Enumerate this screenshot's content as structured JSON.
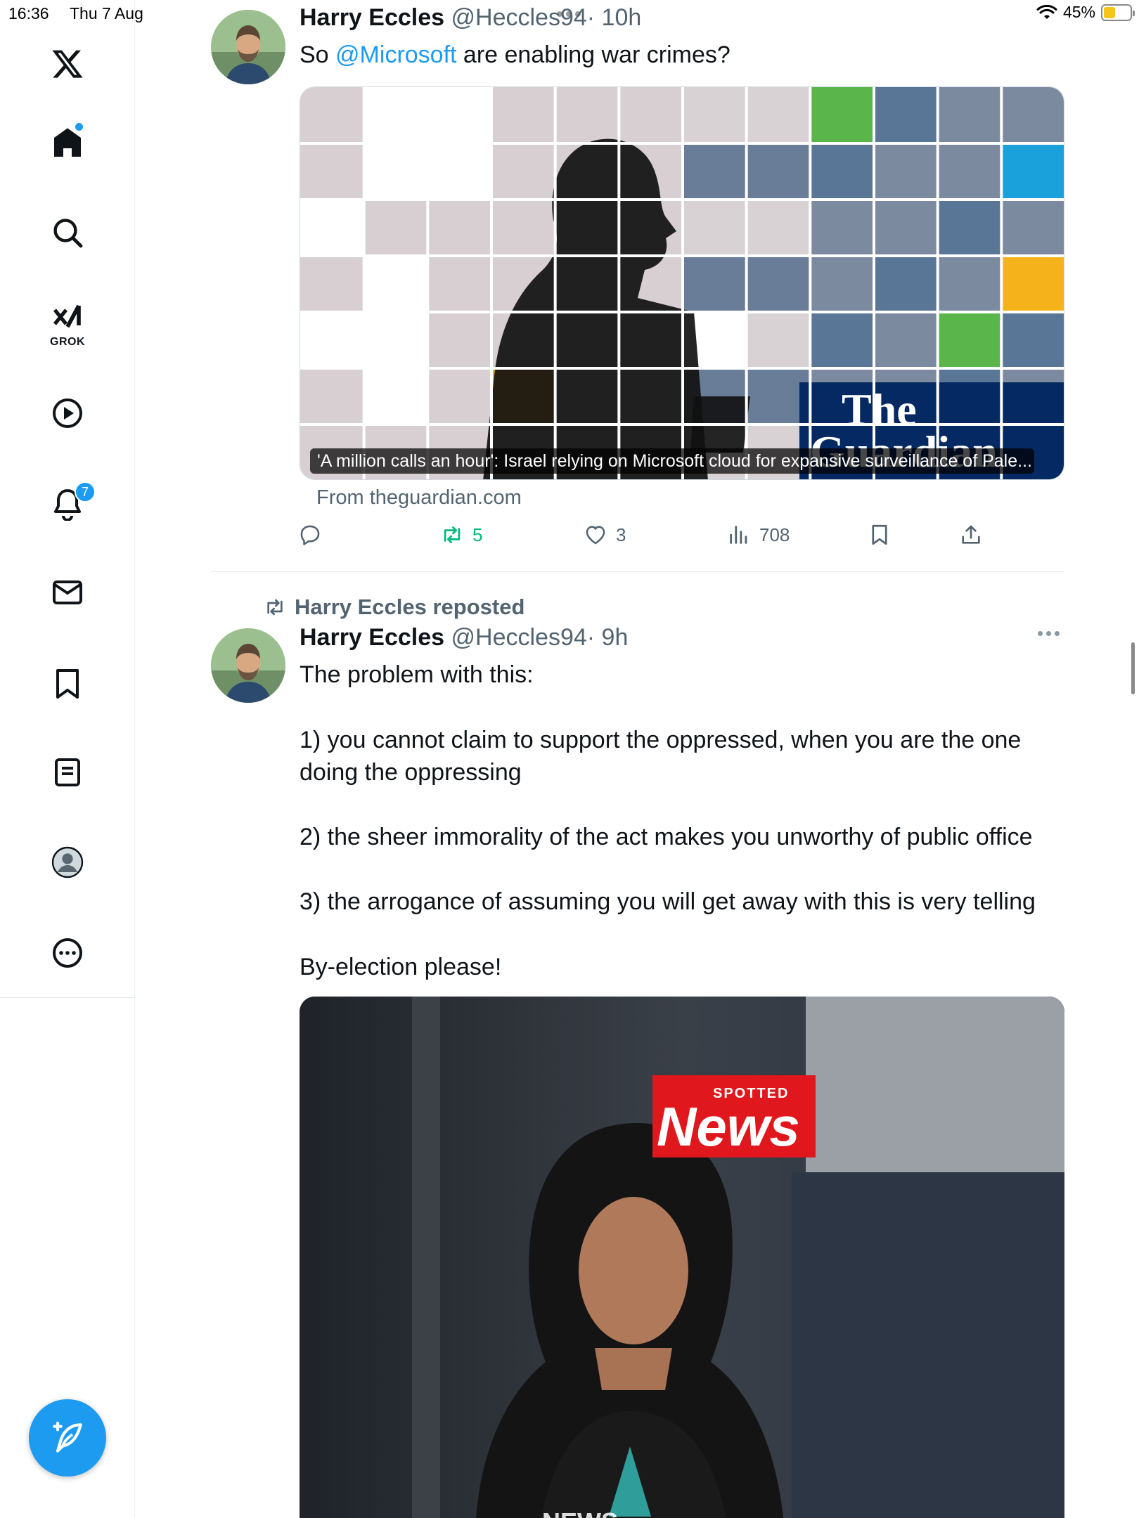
{
  "status_bar": {
    "time": "16:36",
    "date": "Thu 7 Aug",
    "battery": "45%",
    "battery_level": 0.45
  },
  "sidebar": {
    "logo": "x-logo-icon",
    "items": [
      {
        "icon": "home-icon",
        "has_dot": true
      },
      {
        "icon": "search-icon"
      },
      {
        "icon": "grok-icon",
        "label": "GROK"
      },
      {
        "icon": "video-icon"
      },
      {
        "icon": "bell-icon",
        "badge": "7"
      },
      {
        "icon": "mail-icon"
      },
      {
        "icon": "bookmark-icon"
      },
      {
        "icon": "lists-icon"
      },
      {
        "icon": "profile-icon"
      },
      {
        "icon": "more-icon"
      }
    ],
    "compose": "compose-icon"
  },
  "tweet1": {
    "name": "Harry Eccles",
    "handle": "@Heccles94",
    "time": "· 10h",
    "text_prefix": "So ",
    "mention": "@Microsoft",
    "text_suffix": " are enabling war crimes?",
    "card": {
      "caption": "'A million calls an hour': Israel relying on Microsoft cloud for expansive surveillance of Pale...",
      "logo_line1": "The",
      "logo_line2": "Guardian",
      "source": "From theguardian.com"
    },
    "actions": {
      "replies": "",
      "reposts": "5",
      "likes": "3",
      "views": "708"
    }
  },
  "tweet2": {
    "repost_label": "Harry Eccles reposted",
    "name": "Harry Eccles",
    "handle": "@Heccles94",
    "time": "· 9h",
    "lines": [
      "The problem with this:",
      "1) you cannot claim to support the oppressed, when you are the one doing the oppressing",
      "2) the sheer immorality of the act makes you unworthy of public office",
      "3) the arrogance of assuming you will get away with this is very telling",
      "By-election please!"
    ],
    "image": {
      "brand_small": "SPOTTED",
      "brand_big": "News",
      "bottom_text": "NEWS"
    }
  },
  "colors": {
    "accent": "#1d9bf0",
    "repost_green": "#00ba7c",
    "text": "#0f1419",
    "muted": "#536471",
    "guardian_blue": "#052962",
    "spotted_red": "#e0171c"
  }
}
